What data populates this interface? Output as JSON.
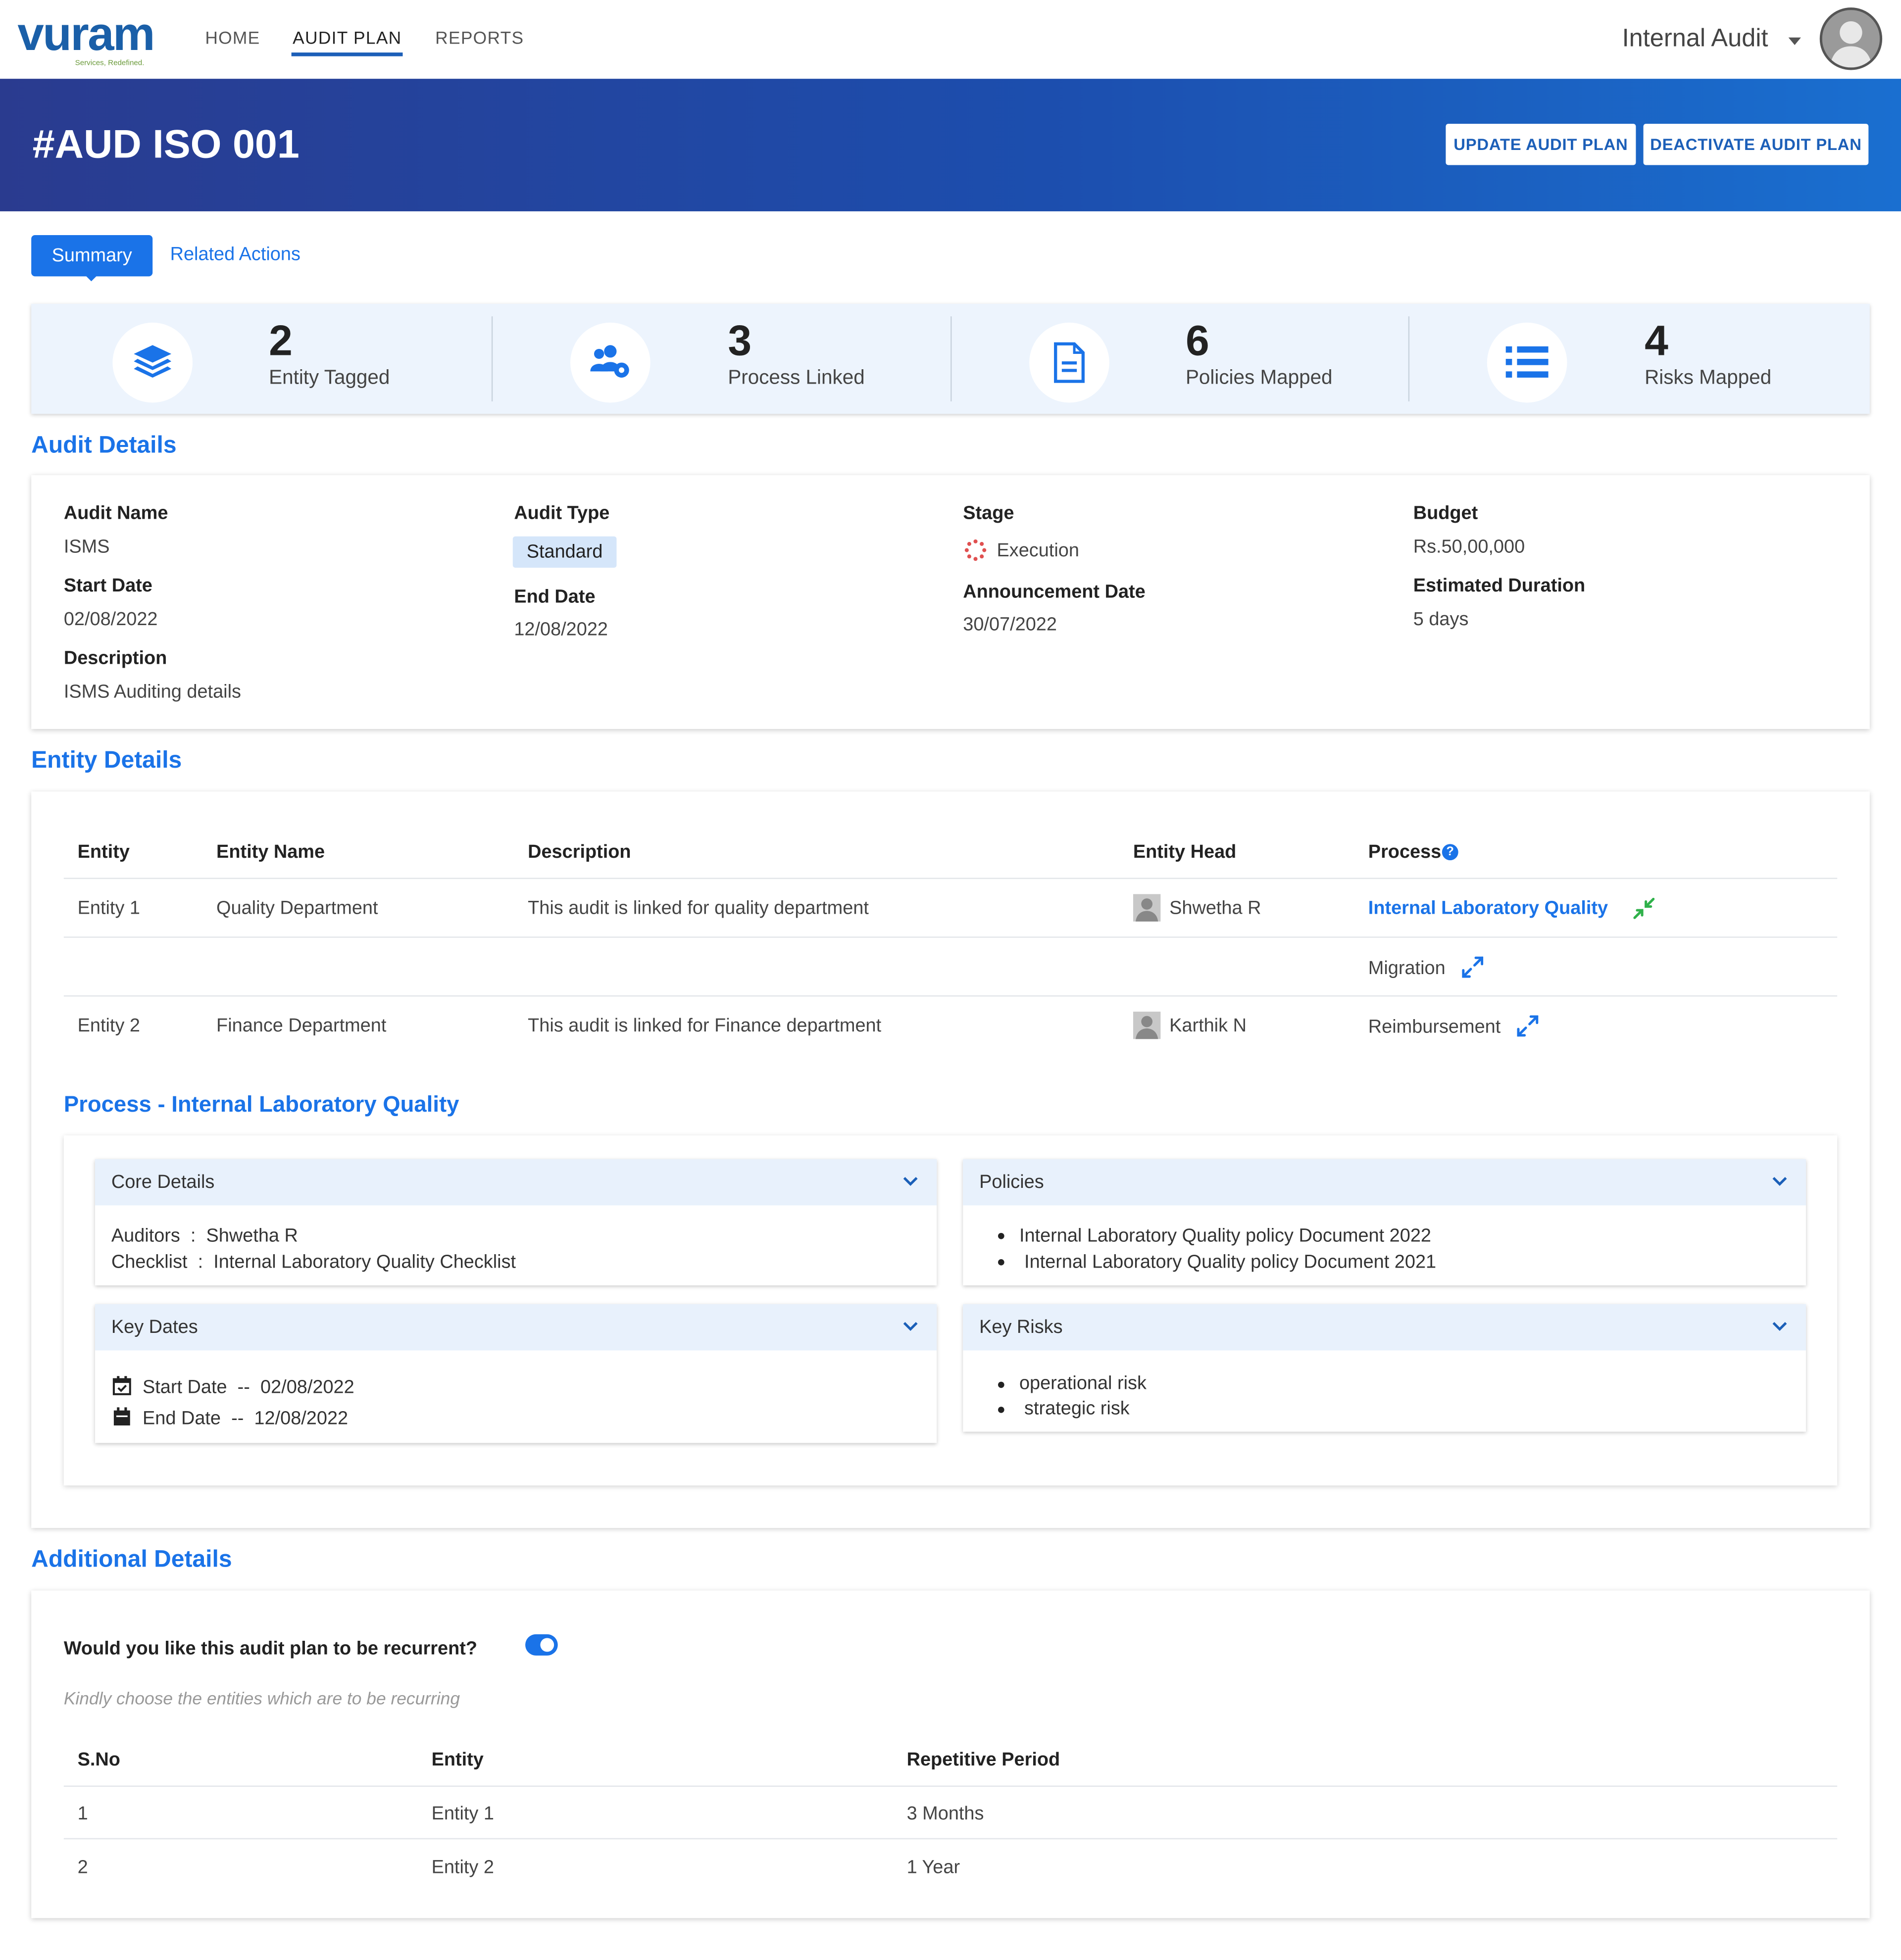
{
  "nav": {
    "logo": "vuram",
    "logo_tagline": "Services, Redefined.",
    "items": [
      "HOME",
      "AUDIT PLAN",
      "REPORTS"
    ],
    "role": "Internal Audit"
  },
  "banner": {
    "title": "#AUD ISO 001",
    "update_label": "UPDATE AUDIT PLAN",
    "deactivate_label": "DEACTIVATE AUDIT PLAN"
  },
  "tabs": {
    "summary": "Summary",
    "related": "Related Actions"
  },
  "stats": [
    {
      "value": "2",
      "label": "Entity Tagged",
      "icon": "layers-icon"
    },
    {
      "value": "3",
      "label": "Process Linked",
      "icon": "users-gear-icon"
    },
    {
      "value": "6",
      "label": "Policies Mapped",
      "icon": "document-icon"
    },
    {
      "value": "4",
      "label": "Risks Mapped",
      "icon": "list-icon"
    }
  ],
  "audit_details": {
    "title": "Audit Details",
    "audit_name_label": "Audit Name",
    "audit_name": "ISMS",
    "start_date_label": "Start Date",
    "start_date": "02/08/2022",
    "description_label": "Description",
    "description": "ISMS Auditing details",
    "audit_type_label": "Audit Type",
    "audit_type": "Standard",
    "end_date_label": "End Date",
    "end_date": "12/08/2022",
    "stage_label": "Stage",
    "stage": "Execution",
    "announcement_label": "Announcement Date",
    "announcement": "30/07/2022",
    "budget_label": "Budget",
    "budget": "Rs.50,00,000",
    "duration_label": "Estimated Duration",
    "duration": "5 days"
  },
  "entity_details": {
    "title": "Entity Details",
    "headers": [
      "Entity",
      "Entity Name",
      "Description",
      "Entity Head",
      "Process"
    ],
    "rows": [
      {
        "entity": "Entity 1",
        "name": "Quality Department",
        "description": "This audit is linked for quality department",
        "head": "Shwetha R",
        "processes": [
          "Internal Laboratory Quality",
          "Migration"
        ]
      },
      {
        "entity": "Entity 2",
        "name": "Finance Department",
        "description": "This audit is linked for Finance department",
        "head": "Karthik N",
        "processes": [
          "Reimbursement"
        ]
      }
    ]
  },
  "process": {
    "title": "Process - Internal Laboratory Quality",
    "core": {
      "title": "Core Details",
      "auditors_label": "Auditors",
      "auditors": "Shwetha R",
      "checklist_label": "Checklist",
      "checklist": "Internal Laboratory Quality Checklist"
    },
    "policies": {
      "title": "Policies",
      "items": [
        "Internal Laboratory Quality policy Document 2022",
        "Internal Laboratory Quality policy Document 2021"
      ]
    },
    "key_dates": {
      "title": "Key Dates",
      "start_label": "Start Date",
      "start": "02/08/2022",
      "end_label": "End Date",
      "end": "12/08/2022",
      "sep": "--"
    },
    "key_risks": {
      "title": "Key Risks",
      "items": [
        "operational risk",
        "strategic risk"
      ]
    }
  },
  "additional": {
    "title": "Additional Details",
    "question": "Would you like this audit plan to be recurrent?",
    "recurrent": true,
    "hint": "Kindly choose the entities which are to be recurring",
    "headers": [
      "S.No",
      "Entity",
      "Repetitive Period"
    ],
    "rows": [
      {
        "sno": "1",
        "entity": "Entity 1",
        "period": "3 Months"
      },
      {
        "sno": "2",
        "entity": "Entity 2",
        "period": "1 Year"
      }
    ]
  },
  "colors": {
    "primary": "#1a73e8",
    "banner_start": "#2a3b8f",
    "banner_end": "#1a6fd0",
    "stage_icon": "#e05050",
    "expand_green": "#2fb14a"
  }
}
